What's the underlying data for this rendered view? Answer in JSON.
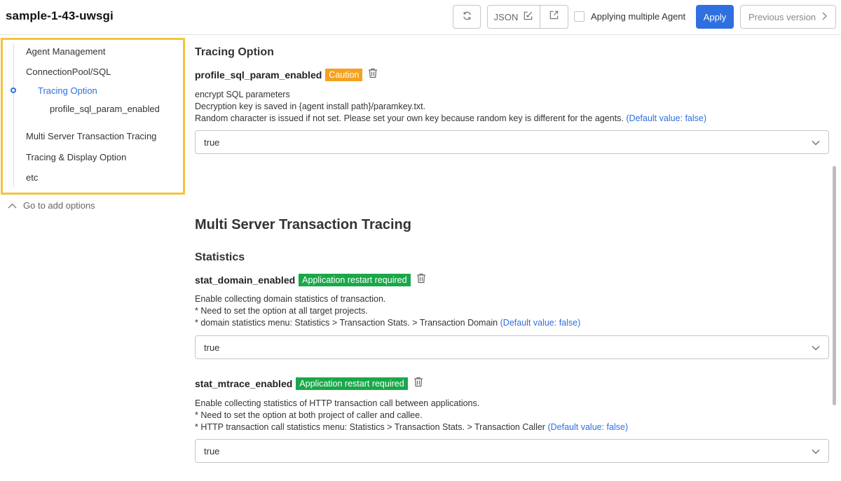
{
  "header": {
    "title": "sample-1-43-uwsgi",
    "json_label": "JSON",
    "multi_agent_label": "Applying multiple Agent",
    "apply_label": "Apply",
    "previous_version_label": "Previous version",
    "accent_color": "#2f6fe0"
  },
  "sidebar": {
    "items": [
      {
        "label": "Agent Management"
      },
      {
        "label": "ConnectionPool/SQL"
      },
      {
        "label": "Tracing Option"
      },
      {
        "label": "profile_sql_param_enabled"
      },
      {
        "label": "Multi Server Transaction Tracing"
      },
      {
        "label": "Tracing & Display Option"
      },
      {
        "label": "etc"
      }
    ],
    "go_to_add_label": "Go to add options",
    "highlight_color": "#f4c33f"
  },
  "main": {
    "tracing_option": {
      "title": "Tracing Option",
      "option": {
        "name": "profile_sql_param_enabled",
        "badge": "Caution",
        "badge_color": "#f5a11f",
        "desc_lines": [
          "encrypt SQL parameters",
          "Decryption key is saved in {agent install path}/paramkey.txt.",
          "Random character is issued if not set. Please set your own key because random key is different for the agents."
        ],
        "default_text": "(Default value: false)",
        "value": "true"
      }
    },
    "multi_server": {
      "title": "Multi Server Transaction Tracing",
      "subtitle": "Statistics",
      "options": [
        {
          "name": "stat_domain_enabled",
          "badge": "Application restart required",
          "badge_color": "#19a849",
          "desc_lines": [
            "Enable collecting domain statistics of transaction.",
            "* Need to set the option at all target projects.",
            "* domain statistics menu: Statistics > Transaction Stats. > Transaction Domain"
          ],
          "default_text": "(Default value: false)",
          "value": "true"
        },
        {
          "name": "stat_mtrace_enabled",
          "badge": "Application restart required",
          "badge_color": "#19a849",
          "desc_lines": [
            "Enable collecting statistics of HTTP transaction call between applications.",
            "* Need to set the option at both project of caller and callee.",
            "* HTTP transaction call statistics menu: Statistics > Transaction Stats. > Transaction Caller"
          ],
          "default_text": "(Default value: false)",
          "value": "true"
        }
      ]
    }
  }
}
